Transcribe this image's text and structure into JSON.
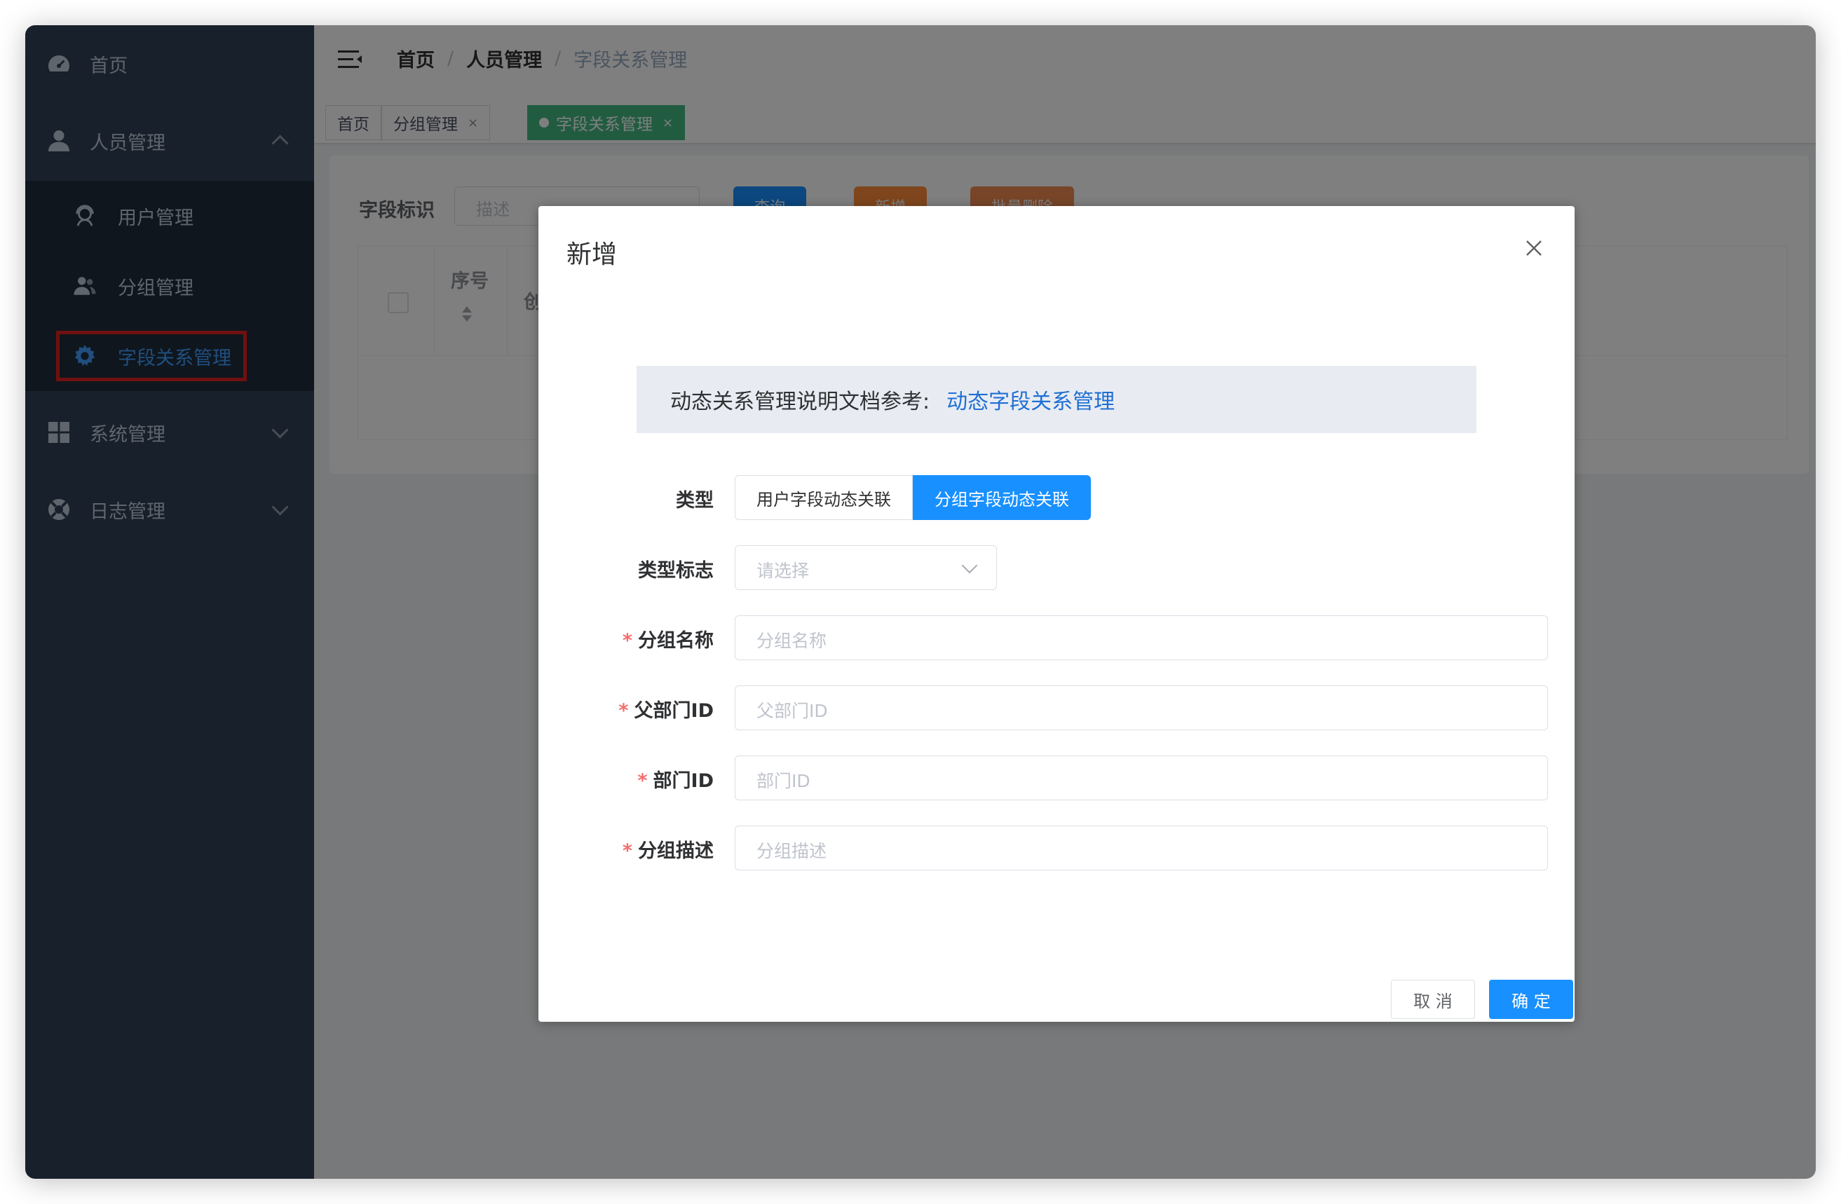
{
  "sidebar": {
    "items": [
      {
        "label": "首页",
        "icon": "dashboard-icon"
      },
      {
        "label": "人员管理",
        "icon": "user-icon",
        "expanded": true,
        "children": [
          {
            "label": "用户管理",
            "icon": "user-headset-icon"
          },
          {
            "label": "分组管理",
            "icon": "group-icon"
          },
          {
            "label": "字段关系管理",
            "icon": "gear-icon",
            "active": true
          }
        ]
      },
      {
        "label": "系统管理",
        "icon": "grid-icon"
      },
      {
        "label": "日志管理",
        "icon": "lifebuoy-icon"
      }
    ]
  },
  "header": {
    "breadcrumb": [
      "首页",
      "人员管理",
      "字段关系管理"
    ]
  },
  "tags": [
    {
      "label": "首页"
    },
    {
      "label": "分组管理",
      "close": "×"
    },
    {
      "label": "字段关系管理",
      "close": "×",
      "active": true
    }
  ],
  "filter": {
    "label": "字段标识",
    "placeholder": "描述",
    "buttons": [
      "查询",
      "新增",
      "批量删除"
    ]
  },
  "table": {
    "headers": [
      "序号",
      "创"
    ]
  },
  "dialog": {
    "title": "新增",
    "info_text": "动态关系管理说明文档参考:",
    "info_link": "动态字段关系管理",
    "type_label": "类型",
    "type_options": [
      "用户字段动态关联",
      "分组字段动态关联"
    ],
    "type_selected": "分组字段动态关联",
    "type_flag_label": "类型标志",
    "type_flag_placeholder": "请选择",
    "fields": [
      {
        "label": "分组名称",
        "placeholder": "分组名称",
        "required": true
      },
      {
        "label": "父部门ID",
        "placeholder": "父部门ID",
        "required": true
      },
      {
        "label": "部门ID",
        "placeholder": "部门ID",
        "required": true
      },
      {
        "label": "分组描述",
        "placeholder": "分组描述",
        "required": true
      }
    ],
    "required_mark": "*",
    "cancel_label": "取 消",
    "confirm_label": "确 定"
  },
  "colors": {
    "sidebar_bg": "#304156",
    "primary": "#1890ff",
    "tag_active": "#42b983",
    "highlight": "#e02020",
    "required": "#f56c6c"
  }
}
